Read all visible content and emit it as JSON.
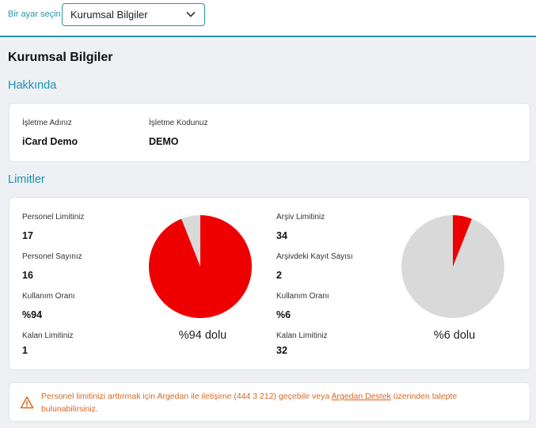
{
  "topbar": {
    "label": "Bir ayar seçin",
    "select_value": "Kurumsal Bilgiler",
    "accent": "#2a93a8"
  },
  "page": {
    "title": "Kurumsal Bilgiler"
  },
  "about": {
    "title": "Hakkında",
    "business_name_label": "İşletme Adınız",
    "business_name_value": "iCard Demo",
    "business_code_label": "İşletme Kodunuz",
    "business_code_value": "DEMO"
  },
  "limits": {
    "title": "Limitler",
    "personnel": {
      "limit_label": "Personel Limitiniz",
      "limit_value": "17",
      "count_label": "Personel Sayınız",
      "count_value": "16",
      "usage_label": "Kullanım Oranı",
      "usage_value": "%94",
      "remaining_label": "Kalan Limitiniz",
      "remaining_value": "1",
      "pie_caption": "%94 dolu",
      "used_fraction": 0.94
    },
    "archive": {
      "limit_label": "Arşiv Limitiniz",
      "limit_value": "34",
      "count_label": "Arşivdeki Kayıt Sayısı",
      "count_value": "2",
      "usage_label": "Kullanım Oranı",
      "usage_value": "%6",
      "remaining_label": "Kalan Limitiniz",
      "remaining_value": "32",
      "pie_caption": "%6 dolu",
      "used_fraction": 0.06
    },
    "colors": {
      "used": "#ee0000",
      "free": "#d9d9d9"
    }
  },
  "alert": {
    "text_before": "Personel limitinizi arttırmak için Argedan ile iletişime (444 3 212) geçebilir veya ",
    "link_text": "Argedan Destek",
    "text_after": " üzerinden talepte bulunabilirsiniz.",
    "color": "#d9661f"
  }
}
